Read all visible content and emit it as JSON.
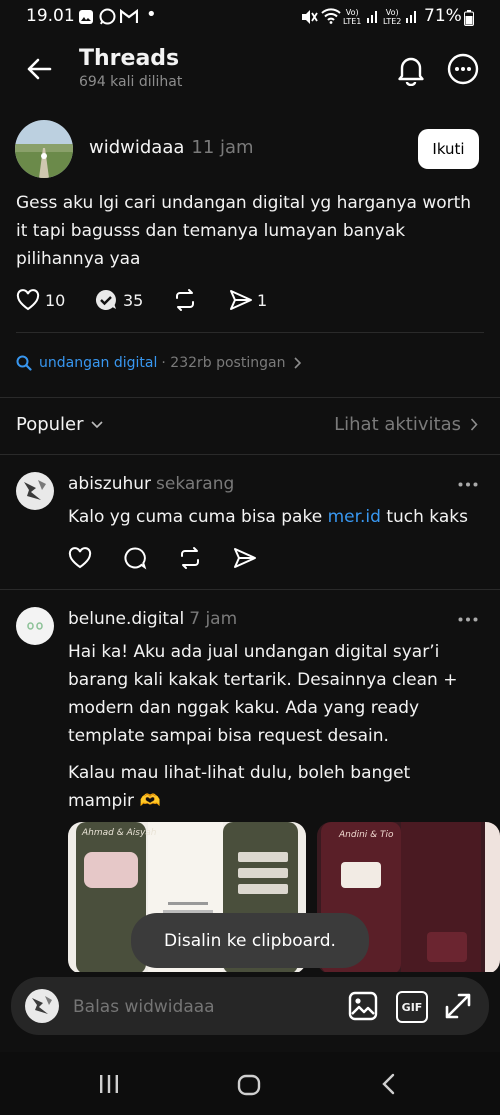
{
  "status_bar": {
    "time": "19.01",
    "battery": "71%",
    "signal1": "LTE1",
    "signal2": "LTE2"
  },
  "header": {
    "title": "Threads",
    "subtitle": "694 kali dilihat"
  },
  "post": {
    "author": "widwidaaa",
    "time": "11 jam",
    "follow_label": "Ikuti",
    "text": "Gess aku lgi cari undangan digital yg harganya worth it tapi bagusss dan temanya lumayan banyak pilihannya yaa",
    "likes": "10",
    "replies": "35",
    "shares": "1"
  },
  "topic": {
    "tag": "undangan digital",
    "count": "· 232rb postingan"
  },
  "sort": {
    "label": "Populer",
    "activity_label": "Lihat aktivitas"
  },
  "replies": [
    {
      "author": "abiszuhur",
      "time": "sekarang",
      "text_before": "Kalo yg cuma cuma bisa pake ",
      "link": "mer.id",
      "text_after": " tuch kaks"
    },
    {
      "author": "belune.digital",
      "time": "7 jam",
      "text": "Hai ka! Aku ada jual undangan digital syar’i barang kali kakak tertarik. Desainnya clean + modern dan nggak kaku. Ada yang ready template sampai bisa request desain.",
      "text2": "Kalau mau lihat-lihat dulu, boleh banget mampir 🫶",
      "card1_title": "Ahmad & Aisyah",
      "card2_title": "Andini & Tio"
    }
  ],
  "toast": "Disalin ke clipboard.",
  "reply_bar": {
    "placeholder": "Balas widwidaaa",
    "gif_label": "GIF"
  },
  "colors": {
    "background": "#101010",
    "link": "#3897f0",
    "muted": "#7a7a7a",
    "toast": "#3b3b3b"
  }
}
